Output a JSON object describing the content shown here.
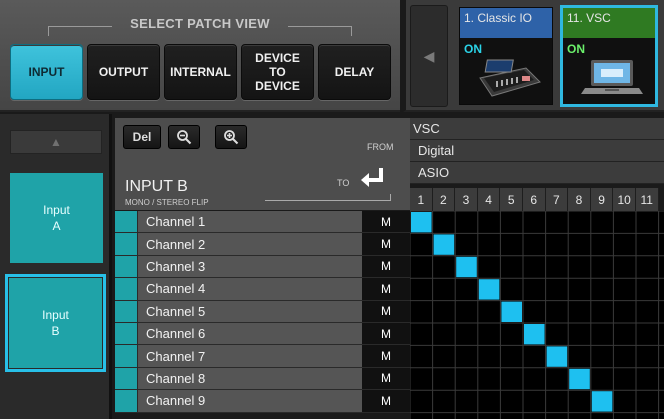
{
  "select_patch_view": {
    "title": "SELECT PATCH VIEW",
    "buttons": [
      {
        "label": "INPUT",
        "active": true
      },
      {
        "label": "OUTPUT",
        "active": false
      },
      {
        "label": "INTERNAL",
        "active": false
      },
      {
        "label": "DEVICE\nTO\nDEVICE",
        "active": false
      },
      {
        "label": "DELAY",
        "active": false
      }
    ]
  },
  "devices": [
    {
      "name": "1. Classic IO",
      "status": "ON",
      "color": "#2e62a8"
    },
    {
      "name": "11. VSC",
      "status": "ON",
      "color": "#2f7a22",
      "selected": true
    }
  ],
  "sidebar": {
    "scroll_up_icon": "triangle-up",
    "items": [
      {
        "label": "Input\nA"
      },
      {
        "label": "Input\nB",
        "selected": true
      }
    ]
  },
  "toolbar": {
    "del_label": "Del",
    "zoom_out_icon": "magnifier-minus",
    "zoom_in_icon": "magnifier-plus",
    "from_label": "FROM",
    "to_label": "TO"
  },
  "selection": {
    "title": "INPUT B",
    "subtitle": "MONO / STEREO FLIP"
  },
  "channels": [
    {
      "name": "Channel 1",
      "mode": "M"
    },
    {
      "name": "Channel 2",
      "mode": "M"
    },
    {
      "name": "Channel 3",
      "mode": "M"
    },
    {
      "name": "Channel 4",
      "mode": "M"
    },
    {
      "name": "Channel 5",
      "mode": "M"
    },
    {
      "name": "Channel 6",
      "mode": "M"
    },
    {
      "name": "Channel 7",
      "mode": "M"
    },
    {
      "name": "Channel 8",
      "mode": "M"
    },
    {
      "name": "Channel 9",
      "mode": "M"
    }
  ],
  "grid": {
    "device": "VSC",
    "type": "Digital",
    "port": "ASIO",
    "columns": [
      "1",
      "2",
      "3",
      "4",
      "5",
      "6",
      "7",
      "8",
      "9",
      "10",
      "11"
    ],
    "patched_pairs": [
      [
        1,
        1
      ],
      [
        2,
        2
      ],
      [
        3,
        3
      ],
      [
        4,
        4
      ],
      [
        5,
        5
      ],
      [
        6,
        6
      ],
      [
        7,
        7
      ],
      [
        8,
        8
      ],
      [
        9,
        9
      ]
    ],
    "accent_color": "#1ec0f0",
    "grid_line_color": "#3a3a3a"
  }
}
